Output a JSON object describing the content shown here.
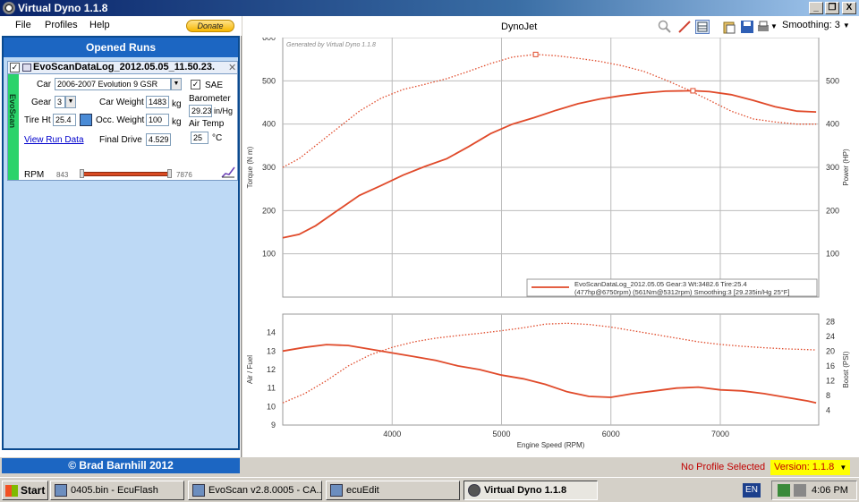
{
  "window": {
    "title": "Virtual Dyno 1.1.8",
    "btn_min": "_",
    "btn_restore": "❐",
    "btn_close": "X"
  },
  "menu": {
    "file": "File",
    "profiles": "Profiles",
    "help": "Help",
    "donate": "Donate"
  },
  "opened_runs": {
    "header": "Opened Runs",
    "run": {
      "name": "EvoScanDataLog_2012.05.05_11.50.23.",
      "tag": "EvoScan",
      "car_label": "Car",
      "car_value": "2006-2007 Evolution 9 GSR",
      "gear_label": "Gear",
      "gear_value": "3",
      "tire_label": "Tire Ht",
      "tire_value": "25.4",
      "car_weight_label": "Car Weight",
      "car_weight_value": "1483",
      "car_weight_unit": "kg",
      "occ_weight_label": "Occ. Weight",
      "occ_weight_value": "100",
      "occ_weight_unit": "kg",
      "final_drive_label": "Final Drive",
      "final_drive_value": "4.529",
      "sae_label": "SAE",
      "barometer_label": "Barometer",
      "barometer_value": "29.235",
      "barometer_unit": "in/Hg",
      "air_temp_label": "Air Temp",
      "air_temp_value": "25",
      "air_temp_unit": "°C",
      "view_run_data": "View Run Data",
      "rpm_label": "RPM",
      "rpm_min": "843",
      "rpm_max": "7876"
    }
  },
  "footer_left": "© Brad Barnhill 2012",
  "toolbar": {
    "chart_name": "DynoJet",
    "smoothing": "Smoothing: 3"
  },
  "status": {
    "profile": "No Profile Selected",
    "version": "Version: 1.1.8"
  },
  "taskbar": {
    "start": "Start",
    "tasks": [
      "0405.bin - EcuFlash",
      "EvoScan v2.8.0005 - CA...",
      "ecuEdit",
      "Virtual Dyno 1.1.8"
    ],
    "lang": "EN",
    "time": "4:06 PM"
  },
  "chart_data": [
    {
      "type": "line",
      "watermark": "Generated by Virtual Dyno 1.1.8",
      "ylabel": "Torque (N m)",
      "y2label": "Power (HP)",
      "ylim": [
        0,
        600
      ],
      "y2lim": [
        0,
        600
      ],
      "yticks": [
        100,
        200,
        300,
        400,
        500,
        600
      ],
      "y2ticks": [
        100,
        200,
        300,
        400,
        500
      ],
      "xlim": [
        3000,
        7900
      ],
      "xticks": [
        4000,
        5000,
        6000,
        7000
      ],
      "color": "#e04a2a",
      "series": [
        {
          "style": "solid",
          "x": [
            3000,
            3150,
            3300,
            3500,
            3700,
            3900,
            4100,
            4300,
            4500,
            4700,
            4900,
            5100,
            5300,
            5500,
            5700,
            5900,
            6100,
            6300,
            6500,
            6750,
            6900,
            7100,
            7300,
            7500,
            7700,
            7876
          ],
          "values": [
            137,
            145,
            165,
            200,
            235,
            258,
            282,
            302,
            320,
            348,
            378,
            400,
            415,
            432,
            447,
            458,
            466,
            472,
            476,
            477,
            475,
            468,
            455,
            440,
            430,
            428
          ]
        },
        {
          "style": "dotted",
          "x": [
            3000,
            3150,
            3300,
            3500,
            3700,
            3900,
            4100,
            4300,
            4500,
            4700,
            4900,
            5100,
            5312,
            5500,
            5700,
            5900,
            6100,
            6300,
            6500,
            6700,
            6900,
            7100,
            7300,
            7500,
            7700,
            7876
          ],
          "values": [
            300,
            320,
            350,
            390,
            430,
            460,
            480,
            492,
            505,
            522,
            540,
            555,
            561,
            558,
            552,
            545,
            535,
            522,
            502,
            480,
            455,
            430,
            412,
            405,
            400,
            400
          ]
        }
      ],
      "markers": [
        {
          "x": 5312,
          "y": 561
        },
        {
          "x": 6750,
          "y": 477
        }
      ],
      "legend": {
        "line1": "EvoScanDataLog_2012.05.05 Gear:3 Wt:3482.6 Tire:25.4",
        "line2": "(477hp@6750rpm) (561Nm@5312rpm) Smoothing:3 [29.235in/Hg 25°F]"
      }
    },
    {
      "type": "line",
      "ylabel": "Air / Fuel",
      "y2label": "Boost (PSI)",
      "xlabel": "Engine Speed (RPM)",
      "ylim": [
        9,
        15
      ],
      "y2lim": [
        0,
        30
      ],
      "yticks": [
        9,
        10,
        11,
        12,
        13,
        14
      ],
      "y2ticks": [
        4,
        8,
        12,
        16,
        20,
        24,
        28
      ],
      "xlim": [
        3000,
        7900
      ],
      "xticks": [
        4000,
        5000,
        6000,
        7000
      ],
      "series": [
        {
          "style": "solid",
          "axis": "left",
          "x": [
            3000,
            3200,
            3400,
            3600,
            3800,
            4000,
            4200,
            4400,
            4600,
            4800,
            5000,
            5200,
            5400,
            5600,
            5800,
            6000,
            6200,
            6400,
            6600,
            6800,
            7000,
            7200,
            7400,
            7600,
            7800,
            7876
          ],
          "values": [
            13.0,
            13.2,
            13.35,
            13.3,
            13.1,
            12.9,
            12.7,
            12.5,
            12.2,
            12.0,
            11.7,
            11.5,
            11.2,
            10.8,
            10.55,
            10.5,
            10.7,
            10.85,
            11.0,
            11.05,
            10.9,
            10.85,
            10.7,
            10.5,
            10.3,
            10.2
          ]
        },
        {
          "style": "dotted",
          "axis": "right",
          "x": [
            3000,
            3200,
            3400,
            3600,
            3800,
            4000,
            4200,
            4400,
            4600,
            4800,
            5000,
            5200,
            5400,
            5600,
            5800,
            6000,
            6200,
            6400,
            6600,
            6800,
            7000,
            7200,
            7400,
            7600,
            7800,
            7876
          ],
          "values": [
            6,
            8.5,
            12,
            16,
            19,
            21,
            22.5,
            23.5,
            24.2,
            24.8,
            25.5,
            26.3,
            27.3,
            27.5,
            27.2,
            26.5,
            25.5,
            24.5,
            23.5,
            22.5,
            21.8,
            21.3,
            20.9,
            20.6,
            20.4,
            20.3
          ]
        }
      ]
    }
  ]
}
